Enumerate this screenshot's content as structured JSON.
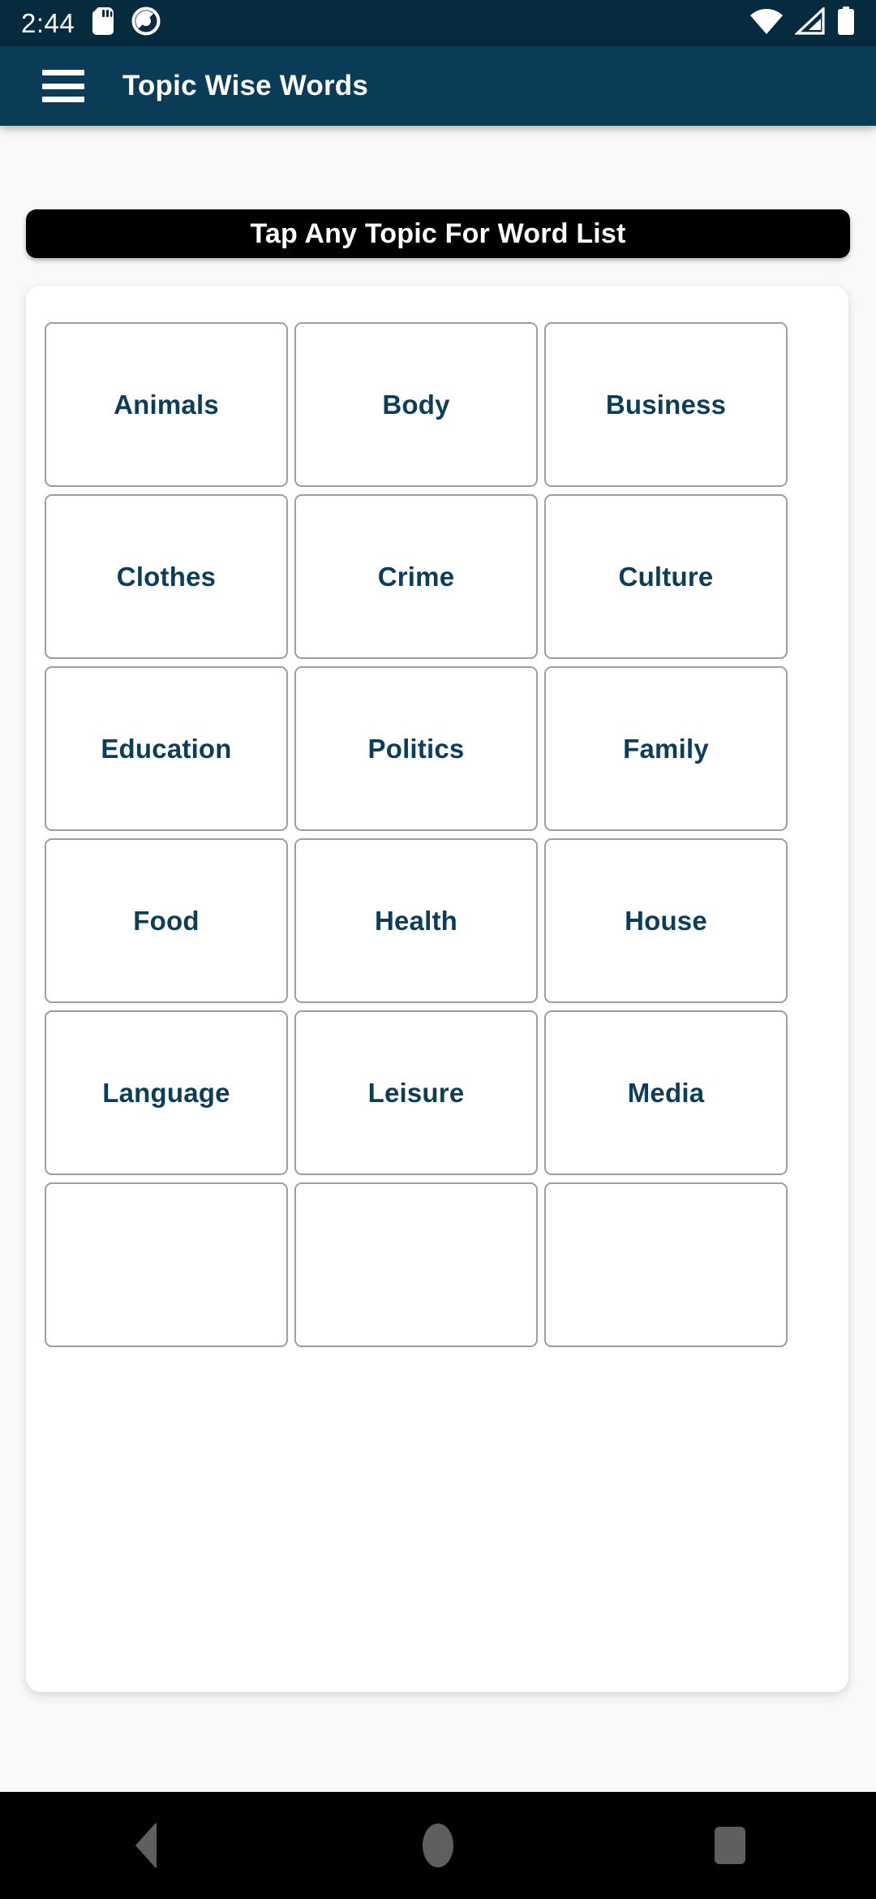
{
  "status_bar": {
    "time": "2:44",
    "icons_left": [
      "sd-card-icon",
      "do-not-disturb-icon"
    ],
    "icons_right": [
      "wifi-icon",
      "signal-icon",
      "battery-icon"
    ],
    "background": "#072b3e"
  },
  "app_bar": {
    "menu_icon": "hamburger-menu-icon",
    "title": "Topic Wise Words",
    "background": "#0a3c57",
    "text_color": "#ffffff"
  },
  "banner": {
    "text": "Tap Any Topic For Word List",
    "background": "#000000",
    "text_color": "#ffffff"
  },
  "topics": {
    "label_color": "#0c3e59",
    "border_color": "#9e9e9e",
    "items": [
      {
        "label": "Animals"
      },
      {
        "label": "Body"
      },
      {
        "label": "Business"
      },
      {
        "label": "Clothes"
      },
      {
        "label": "Crime"
      },
      {
        "label": "Culture"
      },
      {
        "label": "Education"
      },
      {
        "label": "Politics"
      },
      {
        "label": "Family"
      },
      {
        "label": "Food"
      },
      {
        "label": "Health"
      },
      {
        "label": "House"
      },
      {
        "label": "Language"
      },
      {
        "label": "Leisure"
      },
      {
        "label": "Media"
      },
      {
        "label": ""
      },
      {
        "label": ""
      },
      {
        "label": ""
      }
    ]
  },
  "nav_bar": {
    "background": "#000000",
    "buttons": [
      {
        "name": "back-button",
        "icon": "triangle-back-icon"
      },
      {
        "name": "home-button",
        "icon": "circle-home-icon"
      },
      {
        "name": "recents-button",
        "icon": "square-recents-icon"
      }
    ]
  }
}
